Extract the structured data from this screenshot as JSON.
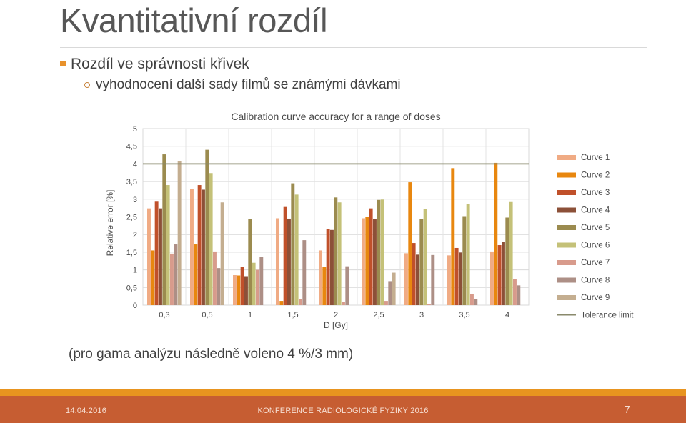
{
  "slide": {
    "title": "Kvantitativní rozdíl",
    "bullet1": "Rozdíl ve správnosti křivek",
    "bullet2": "vyhodnocení další sady filmů se známými dávkami",
    "caption": "(pro gama analýzu následně voleno 4 %/3 mm)"
  },
  "footer": {
    "date": "14.04.2016",
    "center": "KONFERENCE RADIOLOGICKÉ FYZIKY 2016",
    "page": "7",
    "accent_color": "#e8941f",
    "bar_color": "#c65d32",
    "text_color": "#f6ded2"
  },
  "theme": {
    "title_color": "#575757",
    "body_color": "#404040",
    "marker_square_color": "#e8922c",
    "marker_circle_color": "#c8823a",
    "rule_color": "#d9d9d9"
  },
  "chart_data": {
    "type": "bar",
    "title": "Calibration curve accuracy for a range of doses",
    "xlabel": "D [Gy]",
    "ylabel": "Relative error [%]",
    "categories": [
      "0,3",
      "0,5",
      "1",
      "1,5",
      "2",
      "2,5",
      "3",
      "3,5",
      "4"
    ],
    "ylim": [
      0,
      5
    ],
    "ytick_step": 0.5,
    "yticks": [
      "0",
      "0,5",
      "1",
      "1,5",
      "2",
      "2,5",
      "3",
      "3,5",
      "4",
      "4,5",
      "5"
    ],
    "grid": true,
    "legend_position": "right",
    "series": [
      {
        "name": "Curve 1",
        "color": "#f0ab84",
        "values": [
          2.74,
          3.28,
          0.85,
          2.46,
          1.55,
          2.46,
          1.47,
          1.41,
          1.52
        ]
      },
      {
        "name": "Curve 2",
        "color": "#e8870f",
        "values": [
          1.55,
          1.72,
          0.84,
          0.12,
          1.08,
          2.49,
          3.48,
          3.88,
          4.03
        ]
      },
      {
        "name": "Curve 3",
        "color": "#c0502a",
        "values": [
          2.93,
          3.4,
          1.09,
          2.78,
          2.15,
          2.74,
          1.76,
          1.62,
          1.7
        ]
      },
      {
        "name": "Curve 4",
        "color": "#8c5038",
        "values": [
          2.74,
          3.27,
          0.82,
          2.45,
          2.13,
          2.44,
          1.43,
          1.49,
          1.79
        ]
      },
      {
        "name": "Curve 5",
        "color": "#9b8b4f",
        "values": [
          4.27,
          4.4,
          2.43,
          3.45,
          3.05,
          2.98,
          2.44,
          2.52,
          2.48
        ]
      },
      {
        "name": "Curve 6",
        "color": "#c4c178",
        "values": [
          3.4,
          3.74,
          1.2,
          3.13,
          2.91,
          2.99,
          2.72,
          2.87,
          2.92
        ]
      },
      {
        "name": "Curve 7",
        "color": "#d89b8c",
        "values": [
          1.46,
          1.52,
          1.0,
          0.17,
          0.1,
          0.12,
          0.03,
          0.31,
          0.74
        ]
      },
      {
        "name": "Curve 8",
        "color": "#ad8f86",
        "values": [
          1.72,
          1.05,
          1.36,
          1.84,
          1.1,
          0.68,
          1.42,
          0.18,
          0.56
        ]
      },
      {
        "name": "Curve 9",
        "color": "#c4ae90",
        "values": [
          4.08,
          2.91,
          0.0,
          0.0,
          0.0,
          0.92,
          0.0,
          0.0,
          0.0
        ]
      }
    ],
    "tolerance_limit": {
      "label": "Tolerance limit",
      "value": 4.0,
      "color": "#8a8a6c"
    }
  }
}
